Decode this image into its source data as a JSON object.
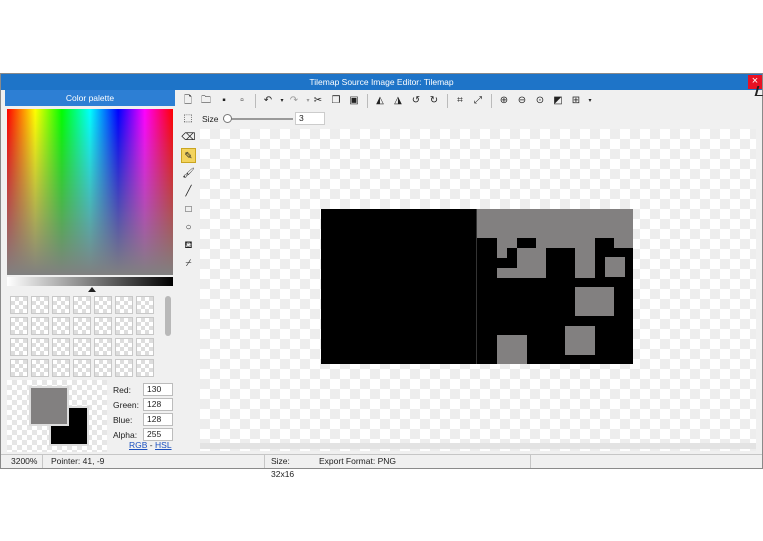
{
  "window": {
    "title": "Tilemap Source Image Editor: Tilemap",
    "close_glyph": "×"
  },
  "palette": {
    "header": "Color palette",
    "primary_color": "#828080",
    "secondary_color": "#000000",
    "channels": [
      {
        "label": "Red:",
        "value": "130"
      },
      {
        "label": "Green:",
        "value": "128"
      },
      {
        "label": "Blue:",
        "value": "128"
      },
      {
        "label": "Alpha:",
        "value": "255"
      }
    ],
    "mode_rgb": "RGB",
    "mode_sep": "-",
    "mode_hsl": "HSL"
  },
  "toolbar": {
    "icons": [
      "new-file-icon",
      "open-folder-icon",
      "save-icon",
      "save-as-icon",
      "undo-icon",
      "redo-icon",
      "cut-icon",
      "copy-icon",
      "paste-icon",
      "flip-horizontal-icon",
      "flip-vertical-icon",
      "rotate-left-icon",
      "rotate-right-icon",
      "crop-icon",
      "resize-icon",
      "zoom-in-icon",
      "zoom-out-icon",
      "zoom-fit-icon",
      "toggle-background-icon",
      "grid-icon"
    ]
  },
  "size_bar": {
    "label": "Size",
    "value": "3"
  },
  "tools": [
    "select-tool",
    "eraser-tool",
    "pencil-tool",
    "brush-tool",
    "line-tool",
    "rectangle-tool",
    "ellipse-tool",
    "fill-tool",
    "eyedropper-tool"
  ],
  "status": {
    "zoom": "3200%",
    "pointer": "Pointer: 41, -9",
    "size": "Size: 32x16",
    "export_format": "Export Format: PNG"
  },
  "colors": {
    "title_bar": "#1e74c8",
    "active_tool": "#f3d35d",
    "tile_gray": "#828080"
  }
}
